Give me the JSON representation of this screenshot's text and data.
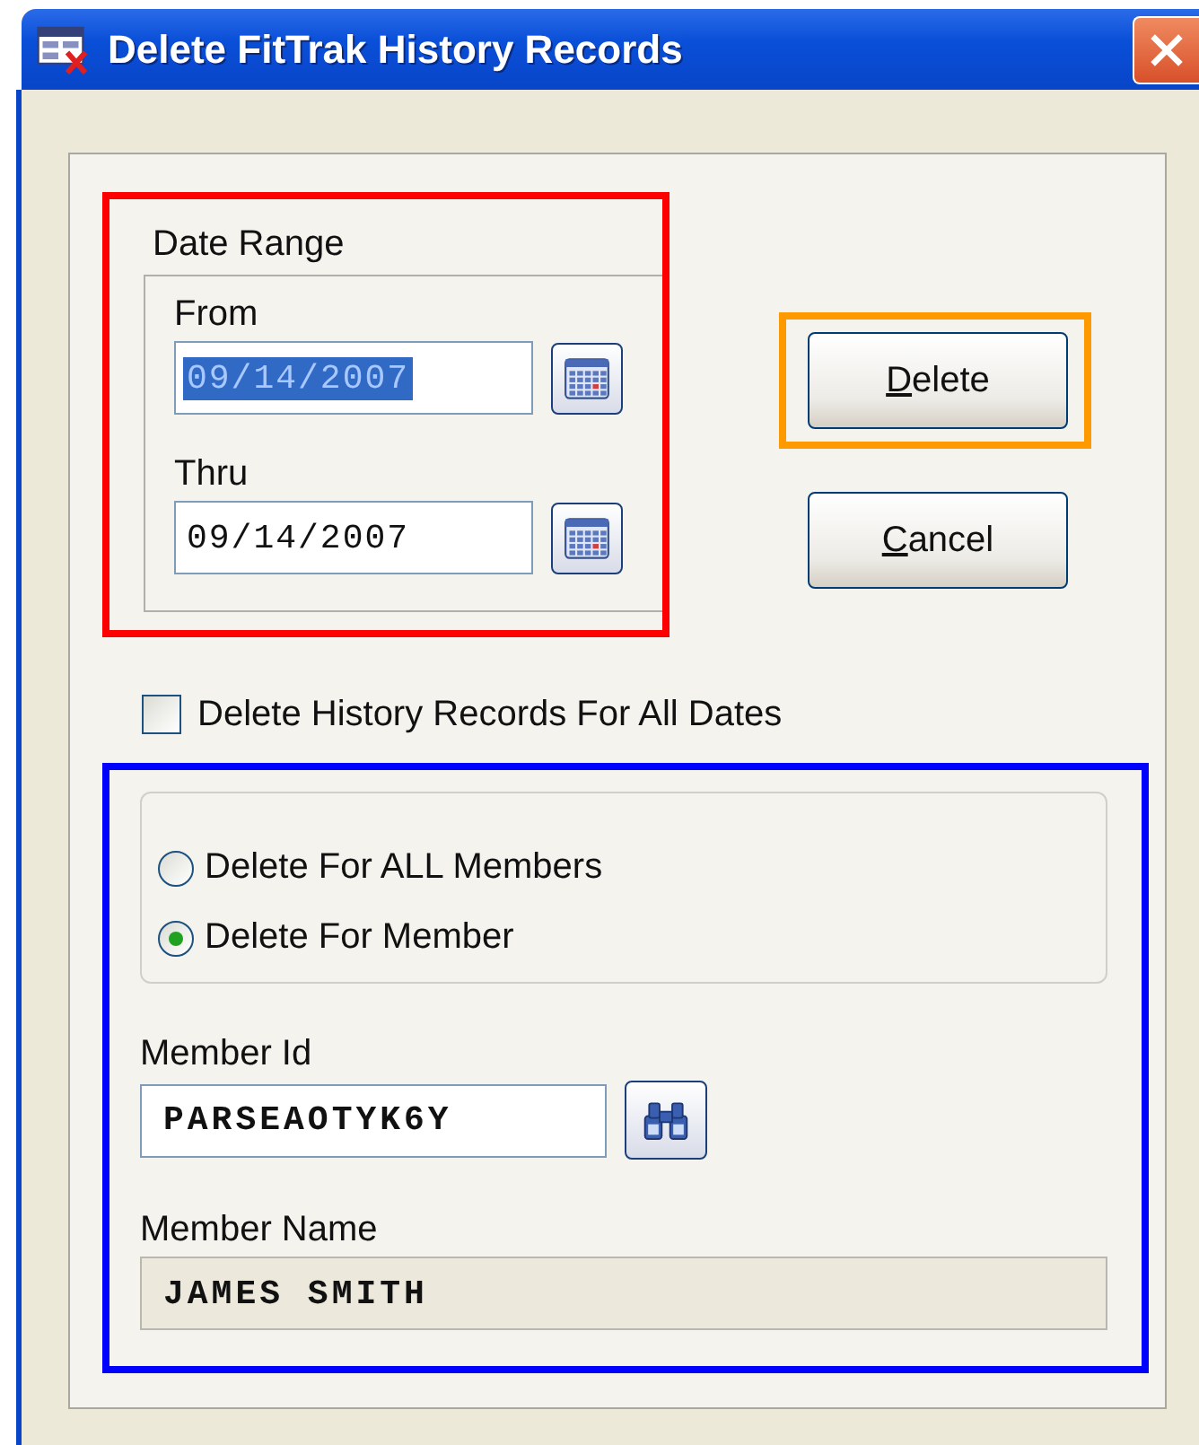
{
  "window": {
    "title": "Delete FitTrak History Records"
  },
  "date_range": {
    "label": "Date Range",
    "color": "#ff0000",
    "fields": [
      {
        "label": "From",
        "value": "09/14/2007",
        "selected": true
      },
      {
        "label": "Thru",
        "value": "09/14/2007",
        "selected": false
      }
    ]
  },
  "buttons": [
    {
      "label": "Delete",
      "color": "#ff9900"
    },
    {
      "label": "Cancel"
    }
  ],
  "all_dates": {
    "label": "Delete History Records For All Dates",
    "checked": false
  },
  "member_section": {
    "color": "#0000ff",
    "scope": [
      {
        "label": "Delete For ALL Members",
        "selected": false
      },
      {
        "label": "Delete For Member",
        "selected": true
      }
    ],
    "member_id": {
      "label": "Member Id",
      "value": "PARSEAOTYK6Y"
    },
    "member_name": {
      "label": "Member Name",
      "value": "JAMES SMITH",
      "disabled": true
    }
  }
}
